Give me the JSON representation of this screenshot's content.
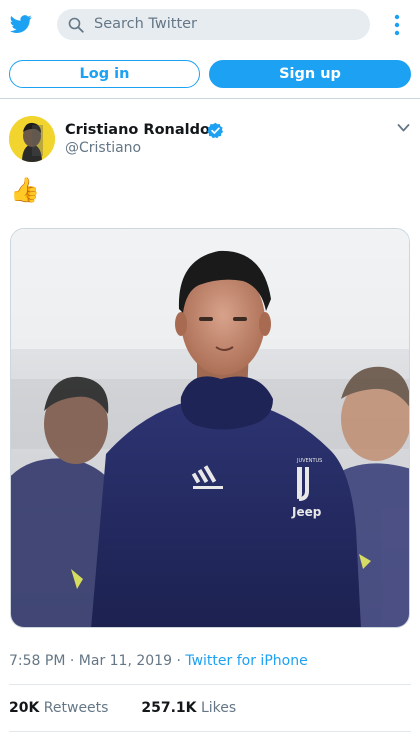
{
  "search": {
    "placeholder": "Search Twitter"
  },
  "auth": {
    "login_label": "Log in",
    "signup_label": "Sign up"
  },
  "tweet": {
    "author": {
      "name": "Cristiano Ronaldo",
      "handle": "@Cristiano",
      "verified": true
    },
    "text": "👍",
    "image": {
      "shirt_text": "Jeep",
      "crest_text": "JUVENTUS"
    },
    "time": "7:58 PM",
    "date": "Mar 11, 2019",
    "source": "Twitter for iPhone",
    "separator": " · ",
    "retweets": {
      "count": "20K",
      "label": "Retweets"
    },
    "likes": {
      "count": "257.1K",
      "label": "Likes"
    }
  },
  "icons": {
    "logo": "twitter-bird-icon",
    "search": "search-icon",
    "menu": "more-vertical-icon",
    "verified": "verified-badge-icon",
    "caret": "chevron-down-icon"
  },
  "colors": {
    "brand": "#1da1f2",
    "text": "#14171a",
    "secondary": "#657786",
    "search_bg": "#e6ecf0",
    "border": "#ccd6dd"
  }
}
